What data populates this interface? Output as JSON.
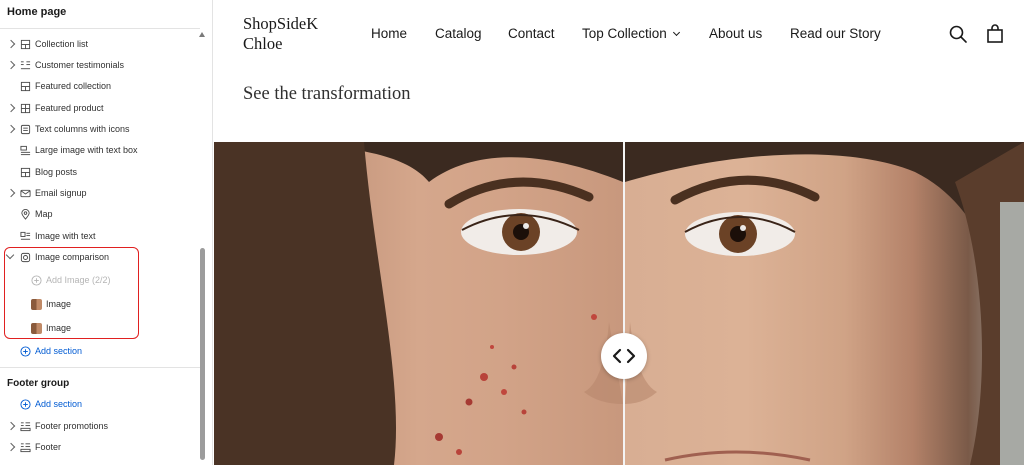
{
  "sidebar": {
    "title": "Home page",
    "items": [
      {
        "label": "Collection list",
        "icon": "section-grid-icon",
        "expandable": true
      },
      {
        "label": "Customer testimonials",
        "icon": "text-columns-icon",
        "expandable": true
      },
      {
        "label": "Featured collection",
        "icon": "section-grid-icon",
        "expandable": false
      },
      {
        "label": "Featured product",
        "icon": "section-grid-icon",
        "expandable": true
      },
      {
        "label": "Text columns with icons",
        "icon": "text-block-icon",
        "expandable": true
      },
      {
        "label": "Large image with text box",
        "icon": "image-text-icon",
        "expandable": false
      },
      {
        "label": "Blog posts",
        "icon": "section-grid-icon",
        "expandable": false
      },
      {
        "label": "Email signup",
        "icon": "email-icon",
        "expandable": true
      },
      {
        "label": "Map",
        "icon": "map-pin-icon",
        "expandable": false
      },
      {
        "label": "Image with text",
        "icon": "image-text-icon",
        "expandable": false
      },
      {
        "label": "Image comparison",
        "icon": "image-comparison-icon",
        "expandable": true,
        "expanded": true
      }
    ],
    "comparison_children": {
      "add_image": "Add Image (2/2)",
      "images": [
        "Image",
        "Image"
      ]
    },
    "add_section": "Add section",
    "footer_group": {
      "title": "Footer group",
      "add_section": "Add section",
      "items": [
        {
          "label": "Footer promotions",
          "icon": "footer-icon",
          "expandable": true
        },
        {
          "label": "Footer",
          "icon": "footer-icon",
          "expandable": true
        }
      ]
    }
  },
  "store": {
    "logo": "ShopSideK Chloe",
    "nav": [
      "Home",
      "Catalog",
      "Contact",
      "Top Collection",
      "About us",
      "Read our Story"
    ],
    "section_title": "See the transformation"
  },
  "colors": {
    "accent_link": "#005bd3",
    "highlight": "#e02020"
  }
}
